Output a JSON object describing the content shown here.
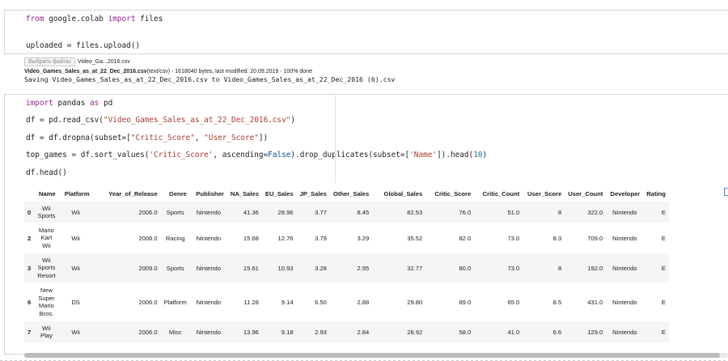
{
  "cell1": {
    "code": {
      "l1_kw_from": "from",
      "l1_mod": " google.colab ",
      "l1_kw_import": "import",
      "l1_rest": " files",
      "l2": "uploaded = files.upload()"
    },
    "output": {
      "file_button": "Выбрать файлы",
      "file_chosen": "Video_Ga...2016.csv",
      "status_name": "Video_Games_Sales_as_at_22_Dec_2016.csv",
      "status_rest": "(text/csv) - 1618040 bytes, last modified: 20.09.2019 - 100% done",
      "saving": "Saving Video_Games_Sales_as_at_22_Dec_2016.csv to Video_Games_Sales_as_at_22_Dec_2016 (6).csv"
    }
  },
  "cell2": {
    "code": {
      "l1_import": "import",
      "l1_mid": " pandas ",
      "l1_as": "as",
      "l1_end": " pd",
      "l2_a": "df = pd.read_csv(",
      "l2_str": "\"Video_Games_Sales_as_at_22_Dec_2016.csv\"",
      "l2_b": ")",
      "l3_a": "df = df.dropna(subset=[",
      "l3_s1": "\"Critic_Score\"",
      "l3_c": ", ",
      "l3_s2": "\"User_Score\"",
      "l3_b": "])",
      "l4_a": "top_games = df.sort_values(",
      "l4_s1": "'Critic_Score'",
      "l4_b": ", ascending=",
      "l4_false": "False",
      "l4_c": ").drop_duplicates(subset=[",
      "l4_s2": "'Name'",
      "l4_d": "]).head(",
      "l4_n": "10",
      "l4_e": ")",
      "l5": "df.head()"
    }
  },
  "table": {
    "columns": [
      "",
      "Name",
      "Platform",
      "Year_of_Release",
      "Genre",
      "Publisher",
      "NA_Sales",
      "EU_Sales",
      "JP_Sales",
      "Other_Sales",
      "Global_Sales",
      "Critic_Score",
      "Critic_Count",
      "User_Score",
      "User_Count",
      "Developer",
      "Rating"
    ],
    "rows": [
      {
        "idx": "0",
        "name": "Wii Sports",
        "platform": "Wii",
        "year": "2006.0",
        "genre": "Sports",
        "publisher": "Nintendo",
        "na": "41.36",
        "eu": "28.96",
        "jp": "3.77",
        "other": "8.45",
        "global": "82.53",
        "critic_score": "76.0",
        "critic_count": "51.0",
        "user_score": "8",
        "user_count": "322.0",
        "developer": "Nintendo",
        "rating": "E"
      },
      {
        "idx": "2",
        "name": "Mario Kart Wii",
        "platform": "Wii",
        "year": "2008.0",
        "genre": "Racing",
        "publisher": "Nintendo",
        "na": "15.68",
        "eu": "12.76",
        "jp": "3.79",
        "other": "3.29",
        "global": "35.52",
        "critic_score": "82.0",
        "critic_count": "73.0",
        "user_score": "8.3",
        "user_count": "709.0",
        "developer": "Nintendo",
        "rating": "E"
      },
      {
        "idx": "3",
        "name": "Wii Sports Resort",
        "platform": "Wii",
        "year": "2009.0",
        "genre": "Sports",
        "publisher": "Nintendo",
        "na": "15.61",
        "eu": "10.93",
        "jp": "3.28",
        "other": "2.95",
        "global": "32.77",
        "critic_score": "80.0",
        "critic_count": "73.0",
        "user_score": "8",
        "user_count": "192.0",
        "developer": "Nintendo",
        "rating": "E"
      },
      {
        "idx": "6",
        "name": "New Super Mario Bros.",
        "platform": "DS",
        "year": "2006.0",
        "genre": "Platform",
        "publisher": "Nintendo",
        "na": "11.28",
        "eu": "9.14",
        "jp": "6.50",
        "other": "2.88",
        "global": "29.80",
        "critic_score": "89.0",
        "critic_count": "65.0",
        "user_score": "8.5",
        "user_count": "431.0",
        "developer": "Nintendo",
        "rating": "E"
      },
      {
        "idx": "7",
        "name": "Wii Play",
        "platform": "Wii",
        "year": "2006.0",
        "genre": "Misc",
        "publisher": "Nintendo",
        "na": "13.96",
        "eu": "9.18",
        "jp": "2.93",
        "other": "2.84",
        "global": "28.92",
        "critic_score": "58.0",
        "critic_count": "41.0",
        "user_score": "6.6",
        "user_count": "129.0",
        "developer": "Nintendo",
        "rating": "E"
      }
    ]
  },
  "icons": {
    "table_action": "table-view-icon"
  },
  "colors": {
    "keyword": "#9b2393",
    "string": "#b03a2e",
    "number": "#1c6b9c",
    "stripe": "#f5f5f5",
    "accent": "#4a7fd1"
  }
}
